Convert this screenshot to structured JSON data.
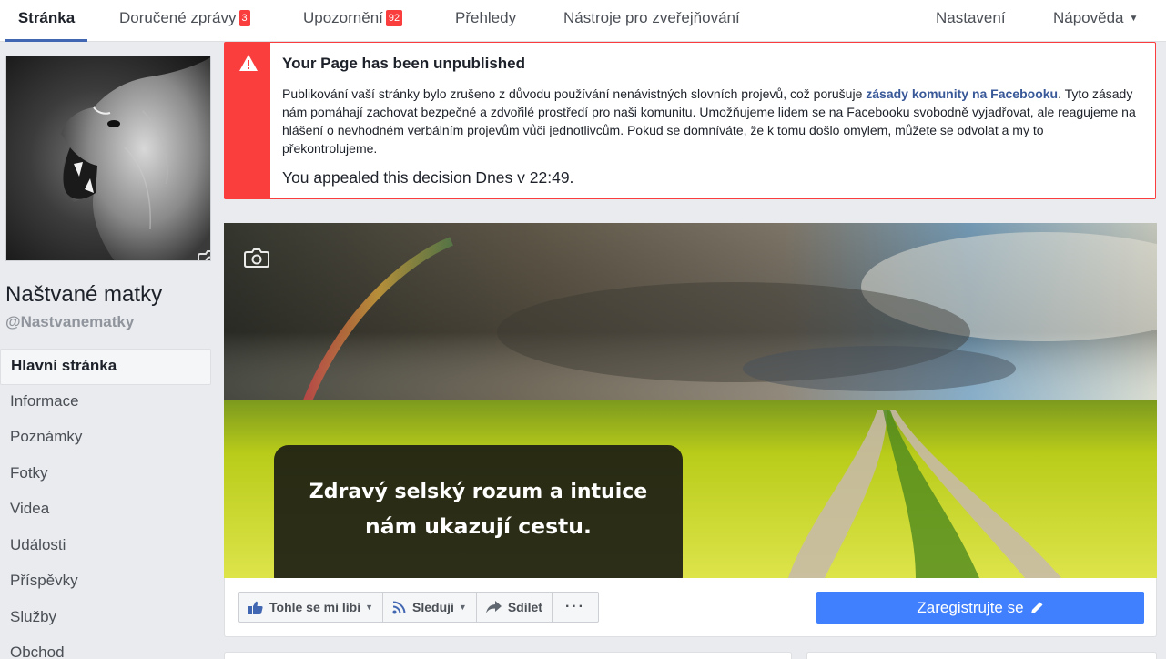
{
  "nav": {
    "tabs": [
      {
        "label": "Stránka"
      },
      {
        "label": "Doručené zprávy",
        "badge": "3"
      },
      {
        "label": "Upozornění",
        "badge": "92"
      },
      {
        "label": "Přehledy"
      },
      {
        "label": "Nástroje pro zveřejňování"
      }
    ],
    "settings": "Nastavení",
    "help": "Nápověda",
    "help_caret": "▼"
  },
  "page": {
    "name": "Naštvané matky",
    "handle": "@Nastvanematky",
    "profile_icon": "camera-icon"
  },
  "sidebar": {
    "items": [
      {
        "label": "Hlavní stránka"
      },
      {
        "label": "Informace"
      },
      {
        "label": "Poznámky"
      },
      {
        "label": "Fotky"
      },
      {
        "label": "Videa"
      },
      {
        "label": "Události"
      },
      {
        "label": "Příspěvky"
      },
      {
        "label": "Služby"
      },
      {
        "label": "Obchod"
      }
    ]
  },
  "alert": {
    "icon": "warning-icon",
    "title": "Your Page has been unpublished",
    "body_before": "Publikování vaší stránky bylo zrušeno z důvodu používání nenávistných slovních projevů, což porušuje ",
    "body_link": "zásady komunity na Facebooku",
    "body_after": ". Tyto zásady nám pomáhají zachovat bezpečné a zdvořilé prostředí pro naši komunitu. Umožňujeme lidem se na Facebooku svobodně vyjadřovat, ale reagujeme na hlášení o nevhodném verbálním projevům vůči jednotlivcům. Pokud se domníváte, že k tomu došlo omylem, můžete se odvolat a my to překontrolujeme.",
    "appeal": "You appealed this decision Dnes v 22:49."
  },
  "cover": {
    "quote_line1": "Zdravý selský rozum a intuice",
    "quote_line2": "nám ukazují cestu.",
    "camera_icon": "camera-icon"
  },
  "actions": {
    "like": "Tohle se mi líbí",
    "follow": "Sleduji",
    "share": "Sdílet",
    "more": "···",
    "register": "Zaregistrujte se"
  },
  "colors": {
    "accent": "#4267b2",
    "alert_red": "#fa3e3e",
    "register_blue": "#4080ff",
    "link": "#385898"
  }
}
